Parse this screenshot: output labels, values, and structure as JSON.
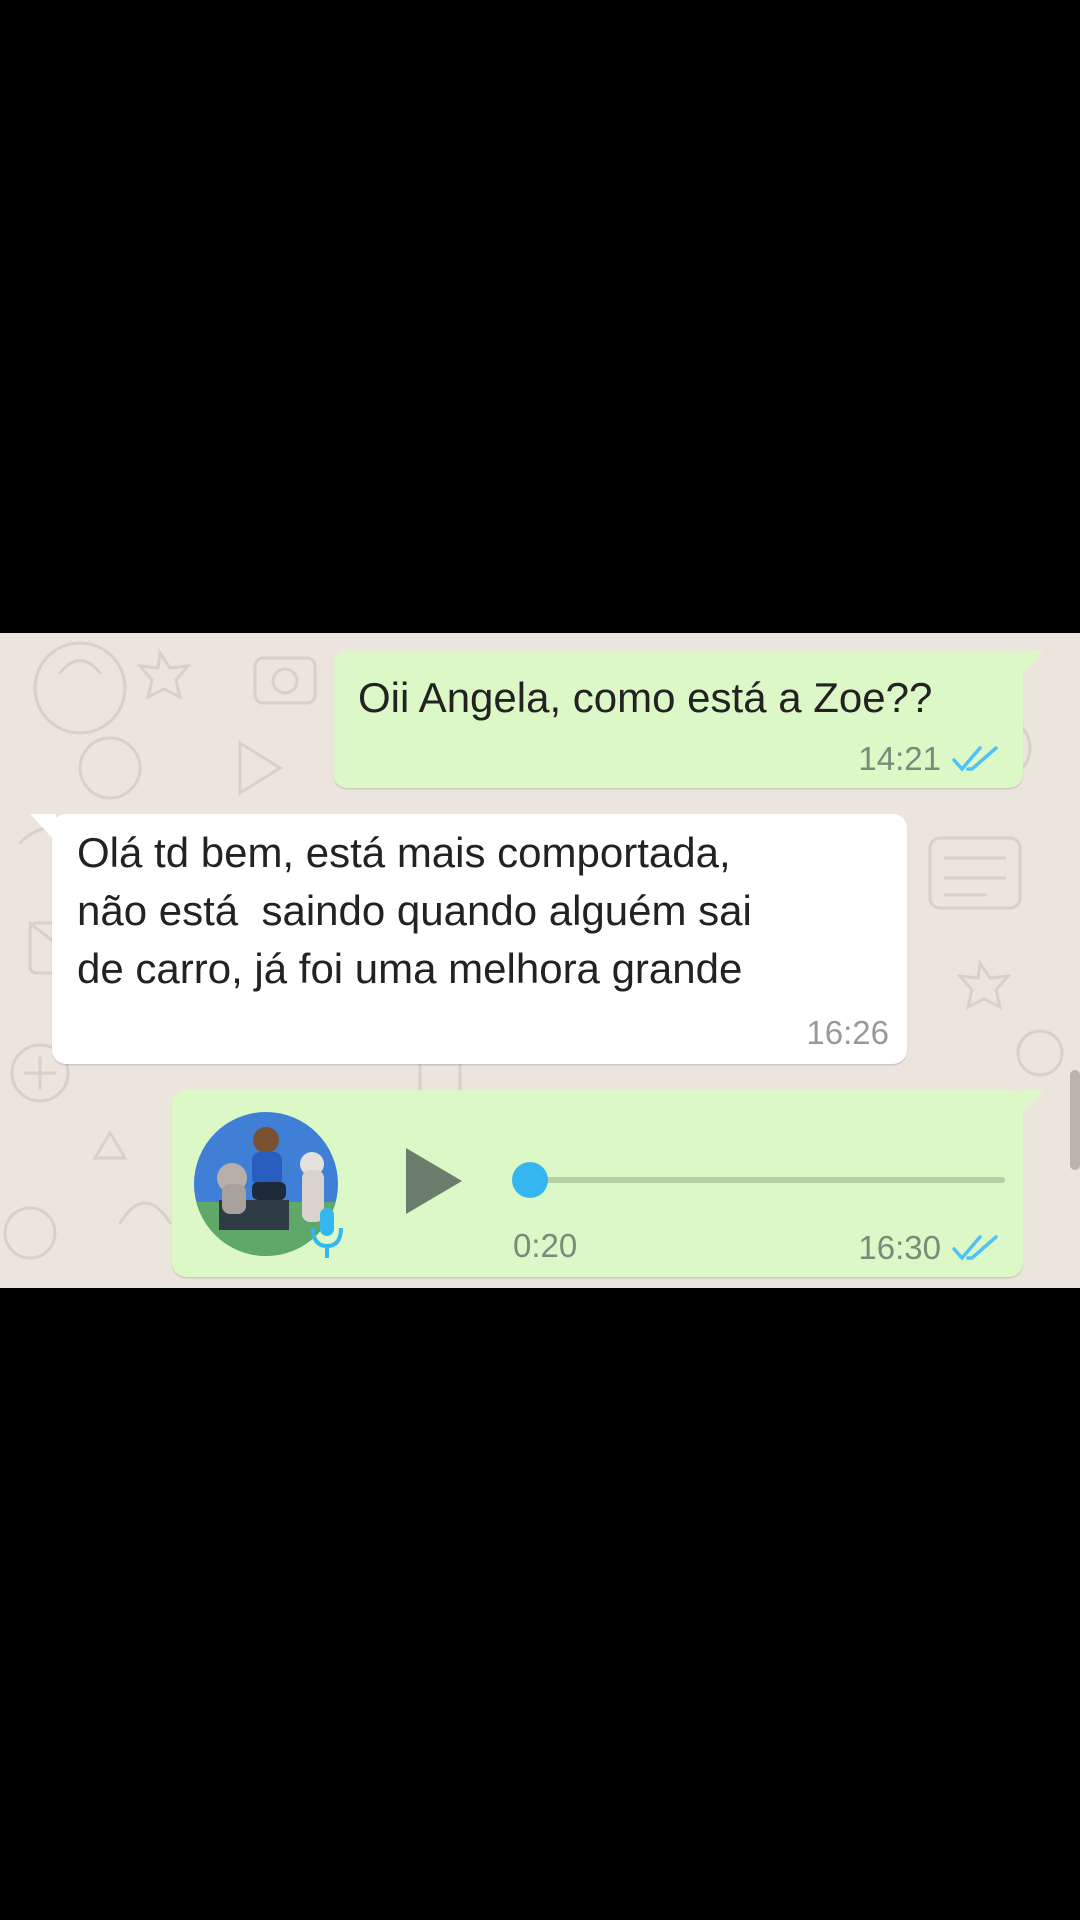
{
  "messages": [
    {
      "direction": "outgoing",
      "text": "Oii Angela, como está a Zoe??",
      "time": "14:21",
      "status": "read",
      "status_icon": "double-check-icon"
    },
    {
      "direction": "incoming",
      "text": "Olá td bem, está mais comportada,\nnão está  saindo quando alguém sai\nde carro, já foi uma melhora grande",
      "time": "16:26"
    },
    {
      "direction": "outgoing",
      "type": "voice",
      "duration": "0:20",
      "playback_progress": 0,
      "time": "16:30",
      "status": "read",
      "status_icon": "double-check-icon",
      "avatar_icon": "profile-photo",
      "mic_icon": "microphone-icon",
      "play_icon": "play-icon"
    }
  ],
  "colors": {
    "outgoing_bubble": "#dcf8c6",
    "incoming_bubble": "#ffffff",
    "chat_background": "#ece5dd",
    "read_ticks": "#4fc3f7",
    "seek_knob": "#34b7f1"
  }
}
